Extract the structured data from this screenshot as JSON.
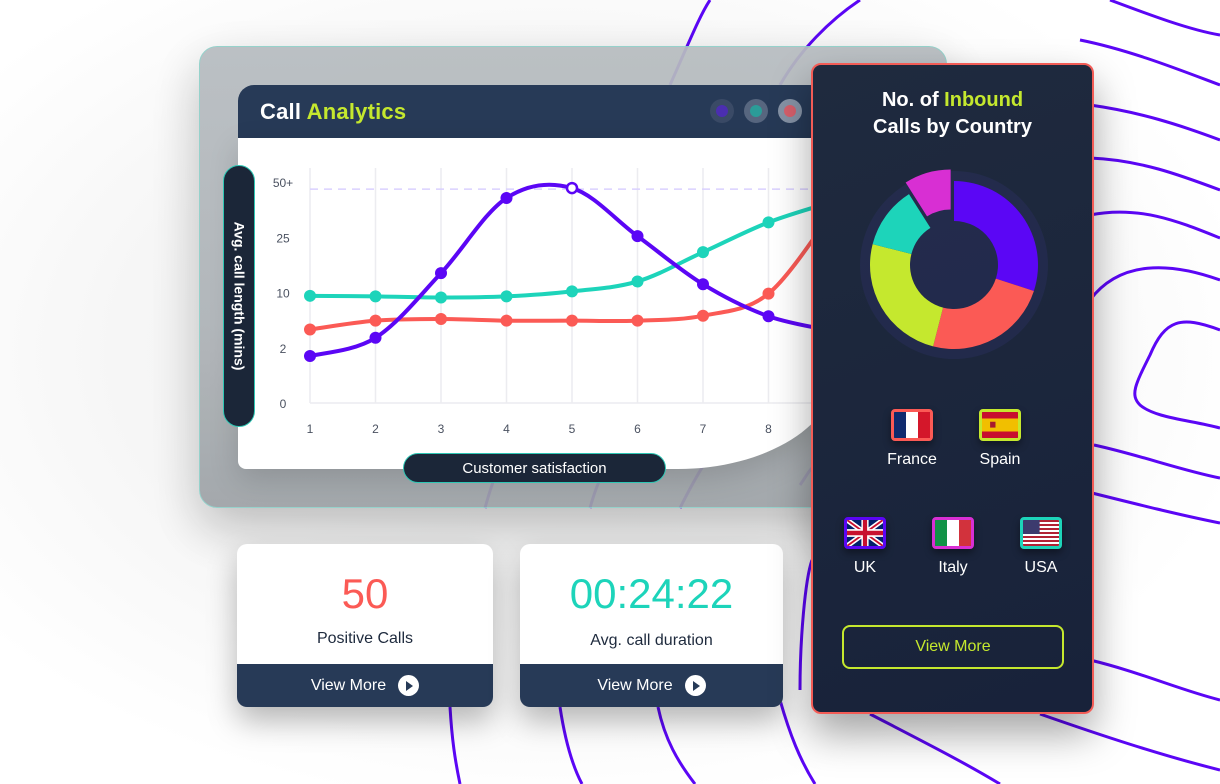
{
  "colors": {
    "purple": "#5b06f5",
    "teal": "#1dd4ba",
    "red": "#fb5a55",
    "lime": "#c5e82e",
    "magenta": "#d82fd3",
    "navy": "#273a57",
    "dark": "#1b2638"
  },
  "analytics_window": {
    "title_part1": "Call",
    "title_part2": "Analytics",
    "window_controls": [
      {
        "name": "minimize",
        "color": "#4b2eb0"
      },
      {
        "name": "maximize",
        "color": "#2b9c98"
      },
      {
        "name": "close",
        "color": "#d55f6b"
      }
    ],
    "y_axis_label": "Avg. call length (mins)",
    "x_axis_label": "Customer satisfaction"
  },
  "chart_data": {
    "type": "line",
    "title": "Call Analytics",
    "xlabel": "Customer satisfaction",
    "ylabel": "Avg. call length (mins)",
    "x": [
      1,
      2,
      3,
      4,
      5,
      6,
      7,
      8,
      9
    ],
    "x_tick_labels": [
      "1",
      "2",
      "3",
      "4",
      "5",
      "6",
      "7",
      "8"
    ],
    "y_tick_labels": [
      "0",
      "2",
      "10",
      "25",
      "50+"
    ],
    "y_scale_note": "categorical ticks, equally spaced; values below are in tick-index units (0=0, 1=2, 2=10, 3=25, 4=50+)",
    "ylim": [
      0,
      4
    ],
    "reference_line": {
      "value": 3.87,
      "style": "dashed",
      "color": "#d9d0ff"
    },
    "grid": "vertical",
    "series": [
      {
        "name": "purple",
        "color": "#5b06f5",
        "values": [
          0.85,
          1.18,
          2.35,
          3.71,
          3.89,
          3.02,
          2.15,
          1.57,
          1.3
        ],
        "highlight_index": 4
      },
      {
        "name": "teal",
        "color": "#1dd4ba",
        "values": [
          1.94,
          1.93,
          1.91,
          1.93,
          2.02,
          2.2,
          2.73,
          3.27,
          3.65
        ]
      },
      {
        "name": "red",
        "color": "#fb5a55",
        "values": [
          1.33,
          1.49,
          1.52,
          1.49,
          1.49,
          1.49,
          1.58,
          1.98,
          3.5
        ]
      }
    ]
  },
  "stats": [
    {
      "value": "50",
      "label": "Positive Calls",
      "value_color": "#fb5a55",
      "button": "View More"
    },
    {
      "value": "00:24:22",
      "label": "Avg. call duration",
      "value_color": "#1dd4ba",
      "button": "View More"
    }
  ],
  "country_panel": {
    "title_part1": "No. of",
    "title_part2": "Inbound",
    "title_line2": "Calls by Country",
    "donut": {
      "type": "pie",
      "segments": [
        {
          "country": "UK",
          "color": "#5b06f5",
          "percent": 30
        },
        {
          "country": "France",
          "color": "#fb5a55",
          "percent": 24
        },
        {
          "country": "Spain",
          "color": "#c5e82e",
          "percent": 25
        },
        {
          "country": "USA",
          "color": "#1dd4ba",
          "percent": 12
        },
        {
          "country": "Italy",
          "color": "#d82fd3",
          "percent": 9,
          "exploded": true
        }
      ]
    },
    "countries": [
      {
        "name": "France",
        "border": "#fb5a55",
        "flag": "france-flag"
      },
      {
        "name": "Spain",
        "border": "#c5e82e",
        "flag": "spain-flag"
      },
      {
        "name": "UK",
        "border": "#5b06f5",
        "flag": "uk-flag"
      },
      {
        "name": "Italy",
        "border": "#d82fd3",
        "flag": "italy-flag"
      },
      {
        "name": "USA",
        "border": "#1dd4ba",
        "flag": "usa-flag"
      }
    ],
    "button": "View More"
  }
}
